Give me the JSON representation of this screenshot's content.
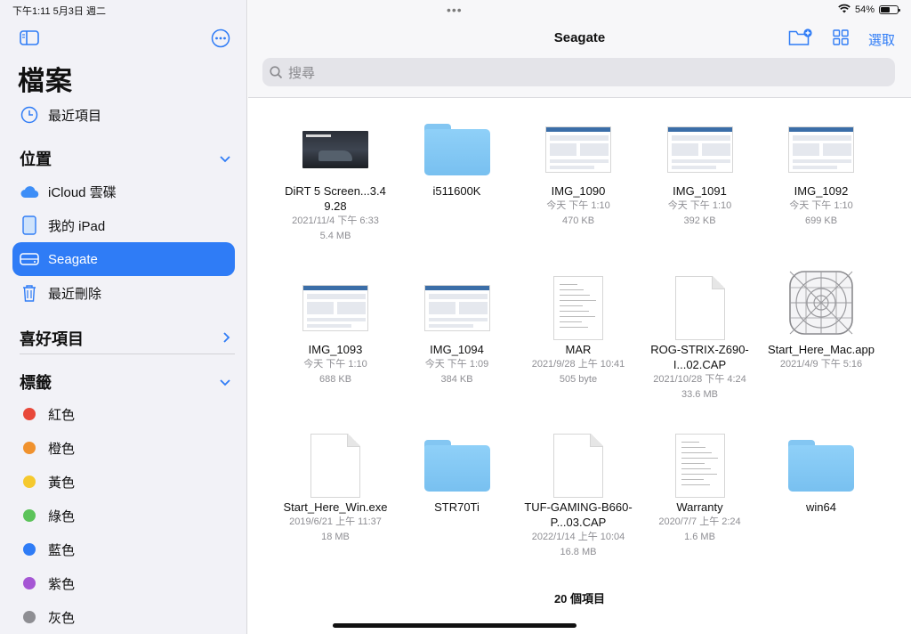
{
  "status_bar": {
    "datetime": "下午1:11   5月3日 週二",
    "battery_text": "54%",
    "battery_level": 0.54
  },
  "sidebar": {
    "title": "檔案",
    "recents": "最近項目",
    "locations_header": "位置",
    "locations": [
      {
        "label": "iCloud 雲碟",
        "icon": "cloud-icon"
      },
      {
        "label": "我的 iPad",
        "icon": "ipad-icon"
      },
      {
        "label": "Seagate",
        "icon": "drive-icon",
        "active": true
      },
      {
        "label": "最近刪除",
        "icon": "trash-icon"
      }
    ],
    "favorites_header": "喜好項目",
    "tags_header": "標籤",
    "tags": [
      {
        "label": "紅色",
        "color": "#e8483a"
      },
      {
        "label": "橙色",
        "color": "#f0922e"
      },
      {
        "label": "黃色",
        "color": "#f5c92e"
      },
      {
        "label": "綠色",
        "color": "#5cc35a"
      },
      {
        "label": "藍色",
        "color": "#2f7cf6"
      },
      {
        "label": "紫色",
        "color": "#a556d4"
      },
      {
        "label": "灰色",
        "color": "#8e8e93"
      }
    ]
  },
  "main": {
    "title": "Seagate",
    "select_label": "選取",
    "search_placeholder": "搜尋",
    "items": [
      {
        "kind": "photo",
        "name": "DiRT 5 Screen...3.49.28",
        "date": "2021/11/4 下午 6:33",
        "size": "5.4 MB"
      },
      {
        "kind": "folder",
        "name": "i511600K",
        "date": "",
        "size": ""
      },
      {
        "kind": "shot",
        "name": "IMG_1090",
        "date": "今天 下午 1:10",
        "size": "470 KB"
      },
      {
        "kind": "shot",
        "name": "IMG_1091",
        "date": "今天 下午 1:10",
        "size": "392 KB"
      },
      {
        "kind": "shot",
        "name": "IMG_1092",
        "date": "今天 下午 1:10",
        "size": "699 KB"
      },
      {
        "kind": "shot",
        "name": "IMG_1093",
        "date": "今天 下午 1:10",
        "size": "688 KB"
      },
      {
        "kind": "shot",
        "name": "IMG_1094",
        "date": "今天 下午 1:09",
        "size": "384 KB"
      },
      {
        "kind": "doc",
        "name": "MAR",
        "date": "2021/9/28 上午 10:41",
        "size": "505 byte"
      },
      {
        "kind": "blank",
        "name": "ROG-STRIX-Z690-I...02.CAP",
        "date": "2021/10/28 下午 4:24",
        "size": "33.6 MB"
      },
      {
        "kind": "app",
        "name": "Start_Here_Mac.app",
        "date": "2021/4/9 下午 5:16",
        "size": ""
      },
      {
        "kind": "blank",
        "name": "Start_Here_Win.exe",
        "date": "2019/6/21 上午 11:37",
        "size": "18 MB"
      },
      {
        "kind": "folder",
        "name": "STR70Ti",
        "date": "",
        "size": ""
      },
      {
        "kind": "blank",
        "name": "TUF-GAMING-B660-P...03.CAP",
        "date": "2022/1/14 上午 10:04",
        "size": "16.8 MB"
      },
      {
        "kind": "doc",
        "name": "Warranty",
        "date": "2020/7/7 上午 2:24",
        "size": "1.6 MB"
      },
      {
        "kind": "folder",
        "name": "win64",
        "date": "",
        "size": ""
      }
    ],
    "count_label": "20 個項目"
  }
}
